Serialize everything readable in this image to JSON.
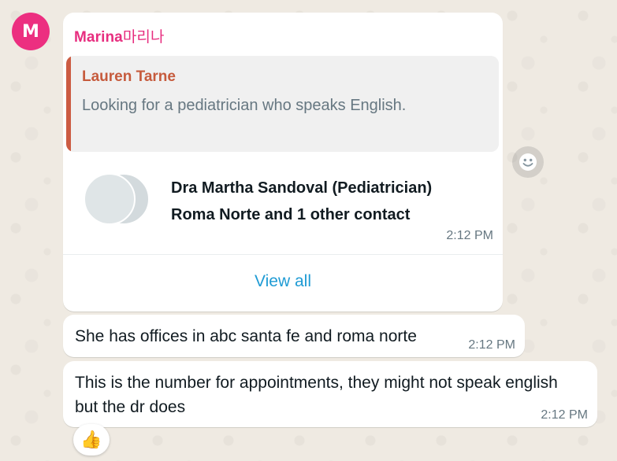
{
  "sender": {
    "avatar_initial": "M",
    "avatar_color": "#ec2f80",
    "name": "Marina",
    "name_tail": "마리나",
    "name_color": "#e72e7f"
  },
  "quoted_message": {
    "author": "Lauren Tarne",
    "author_color": "#c65b3d",
    "text": "Looking for a pediatrician who speaks English."
  },
  "contact_card": {
    "name": "Dra Martha Sandoval (Pediatrician)",
    "subtitle": "Roma Norte and 1 other contact",
    "time": "2:12 PM",
    "view_all_label": "View all",
    "link_color": "#1f9bd4"
  },
  "react_button_icon": "smiley-icon",
  "messages": [
    {
      "text": "She has offices in abc santa fe and roma norte",
      "time": "2:12 PM"
    },
    {
      "text": "This is the number for appointments, they might not speak english but the dr does",
      "time": "2:12 PM"
    }
  ],
  "reaction": {
    "emoji": "👍",
    "icon": "thumbs-up-icon"
  }
}
